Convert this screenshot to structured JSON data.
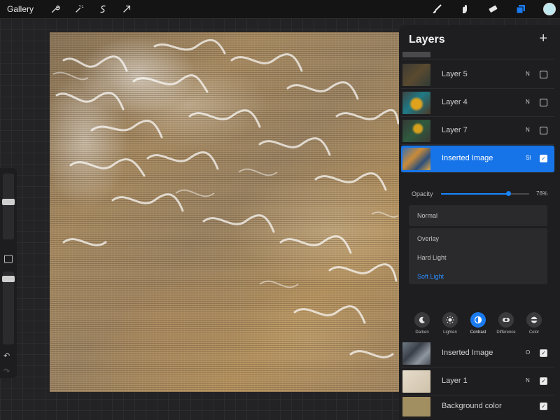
{
  "topbar": {
    "gallery_label": "Gallery",
    "left_icons": [
      "wrench-icon",
      "magic-wand-icon",
      "selection-icon",
      "transform-arrow-icon"
    ],
    "right_icons": [
      "brush-icon",
      "smudge-icon",
      "eraser-icon",
      "layers-icon"
    ],
    "active_color": "#bfe9ef"
  },
  "layers_panel": {
    "title": "Layers",
    "add_label": "+",
    "top_layers": [
      {
        "name": "Layer 5",
        "mode": "N",
        "visible": false
      },
      {
        "name": "Layer 4",
        "mode": "N",
        "visible": false
      },
      {
        "name": "Layer 7",
        "mode": "N",
        "visible": false
      },
      {
        "name": "Inserted Image",
        "mode": "Sl",
        "visible": true,
        "selected": true
      }
    ],
    "opacity": {
      "label": "Opacity",
      "value_text": "76%",
      "value": 0.76
    },
    "blend_current": "Normal",
    "blend_modes": [
      "Overlay",
      "Hard Light",
      "Soft Light"
    ],
    "blend_active": "Soft Light",
    "categories": [
      {
        "label": "Darken",
        "icon": "moon-icon"
      },
      {
        "label": "Lighten",
        "icon": "sun-icon"
      },
      {
        "label": "Contrast",
        "icon": "contrast-icon",
        "active": true
      },
      {
        "label": "Difference",
        "icon": "difference-icon"
      },
      {
        "label": "Color",
        "icon": "color-icon"
      }
    ],
    "bottom_layers": [
      {
        "name": "Inserted Image",
        "mode": "O",
        "visible": true
      },
      {
        "name": "Layer 1",
        "mode": "N",
        "visible": true
      },
      {
        "name": "Background color",
        "mode": "",
        "visible": true
      }
    ]
  },
  "sidebar": {
    "undo_label": "↶",
    "redo_label": "↷"
  },
  "colors": {
    "accent": "#1674e8",
    "background_layer": "#a18f62"
  }
}
